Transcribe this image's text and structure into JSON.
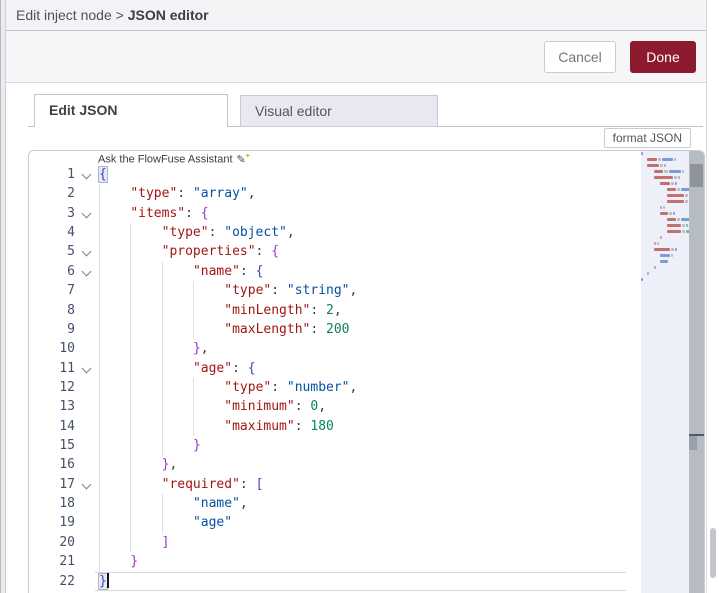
{
  "header": {
    "breadcrumb": {
      "parent": "Edit inject node",
      "separator": " > ",
      "current": "JSON editor"
    }
  },
  "toolbar": {
    "cancel_label": "Cancel",
    "done_label": "Done"
  },
  "main": {
    "tabs": [
      {
        "label": "Edit JSON",
        "active": true
      },
      {
        "label": "Visual editor",
        "active": false
      }
    ]
  },
  "editor": {
    "assistant_label": "Ask the FlowFuse Assistant",
    "assistant_icon": "pencil-icon",
    "format_button_label": "format JSON",
    "cursor_line": 22,
    "lines": [
      {
        "n": 1,
        "fold": true,
        "indent": 0,
        "tokens": [
          {
            "t": "{",
            "c": "bb",
            "m": true
          }
        ]
      },
      {
        "n": 2,
        "indent": 4,
        "tokens": [
          {
            "t": "\"type\"",
            "c": "key"
          },
          {
            "t": ": ",
            "c": "pln"
          },
          {
            "t": "\"array\"",
            "c": "str"
          },
          {
            "t": ",",
            "c": "pln"
          }
        ]
      },
      {
        "n": 3,
        "fold": true,
        "indent": 4,
        "tokens": [
          {
            "t": "\"items\"",
            "c": "key"
          },
          {
            "t": ": ",
            "c": "pln"
          },
          {
            "t": "{",
            "c": "bp"
          }
        ]
      },
      {
        "n": 4,
        "indent": 8,
        "tokens": [
          {
            "t": "\"type\"",
            "c": "key"
          },
          {
            "t": ": ",
            "c": "pln"
          },
          {
            "t": "\"object\"",
            "c": "str"
          },
          {
            "t": ",",
            "c": "pln"
          }
        ]
      },
      {
        "n": 5,
        "fold": true,
        "indent": 8,
        "tokens": [
          {
            "t": "\"properties\"",
            "c": "key"
          },
          {
            "t": ": ",
            "c": "pln"
          },
          {
            "t": "{",
            "c": "bp"
          }
        ]
      },
      {
        "n": 6,
        "fold": true,
        "indent": 12,
        "tokens": [
          {
            "t": "\"name\"",
            "c": "key"
          },
          {
            "t": ": ",
            "c": "pln"
          },
          {
            "t": "{",
            "c": "bb"
          }
        ]
      },
      {
        "n": 7,
        "indent": 16,
        "tokens": [
          {
            "t": "\"type\"",
            "c": "key"
          },
          {
            "t": ": ",
            "c": "pln"
          },
          {
            "t": "\"string\"",
            "c": "str"
          },
          {
            "t": ",",
            "c": "pln"
          }
        ]
      },
      {
        "n": 8,
        "indent": 16,
        "tokens": [
          {
            "t": "\"minLength\"",
            "c": "key"
          },
          {
            "t": ": ",
            "c": "pln"
          },
          {
            "t": "2",
            "c": "num"
          },
          {
            "t": ",",
            "c": "pln"
          }
        ]
      },
      {
        "n": 9,
        "indent": 16,
        "tokens": [
          {
            "t": "\"maxLength\"",
            "c": "key"
          },
          {
            "t": ": ",
            "c": "pln"
          },
          {
            "t": "200",
            "c": "num"
          }
        ]
      },
      {
        "n": 10,
        "indent": 12,
        "tokens": [
          {
            "t": "}",
            "c": "bp"
          },
          {
            "t": ",",
            "c": "pln"
          }
        ]
      },
      {
        "n": 11,
        "fold": true,
        "indent": 12,
        "tokens": [
          {
            "t": "\"age\"",
            "c": "key"
          },
          {
            "t": ": ",
            "c": "pln"
          },
          {
            "t": "{",
            "c": "bb"
          }
        ]
      },
      {
        "n": 12,
        "indent": 16,
        "tokens": [
          {
            "t": "\"type\"",
            "c": "key"
          },
          {
            "t": ": ",
            "c": "pln"
          },
          {
            "t": "\"number\"",
            "c": "str"
          },
          {
            "t": ",",
            "c": "pln"
          }
        ]
      },
      {
        "n": 13,
        "indent": 16,
        "tokens": [
          {
            "t": "\"minimum\"",
            "c": "key"
          },
          {
            "t": ": ",
            "c": "pln"
          },
          {
            "t": "0",
            "c": "num"
          },
          {
            "t": ",",
            "c": "pln"
          }
        ]
      },
      {
        "n": 14,
        "indent": 16,
        "tokens": [
          {
            "t": "\"maximum\"",
            "c": "key"
          },
          {
            "t": ": ",
            "c": "pln"
          },
          {
            "t": "180",
            "c": "num"
          }
        ]
      },
      {
        "n": 15,
        "indent": 12,
        "tokens": [
          {
            "t": "}",
            "c": "bp"
          }
        ]
      },
      {
        "n": 16,
        "indent": 8,
        "tokens": [
          {
            "t": "}",
            "c": "bp"
          },
          {
            "t": ",",
            "c": "pln"
          }
        ]
      },
      {
        "n": 17,
        "fold": true,
        "indent": 8,
        "tokens": [
          {
            "t": "\"required\"",
            "c": "key"
          },
          {
            "t": ": ",
            "c": "pln"
          },
          {
            "t": "[",
            "c": "bb"
          }
        ]
      },
      {
        "n": 18,
        "indent": 12,
        "tokens": [
          {
            "t": "\"name\"",
            "c": "str"
          },
          {
            "t": ",",
            "c": "pln"
          }
        ]
      },
      {
        "n": 19,
        "indent": 12,
        "tokens": [
          {
            "t": "\"age\"",
            "c": "str"
          }
        ]
      },
      {
        "n": 20,
        "indent": 8,
        "tokens": [
          {
            "t": "]",
            "c": "bp"
          }
        ]
      },
      {
        "n": 21,
        "indent": 4,
        "tokens": [
          {
            "t": "}",
            "c": "bp"
          }
        ]
      },
      {
        "n": 22,
        "indent": 0,
        "current": true,
        "cursor": true,
        "tokens": [
          {
            "t": "}",
            "c": "bb",
            "m": true
          }
        ]
      }
    ]
  },
  "colors": {
    "done_button": "#8c1b2e",
    "token_key": "#a31515",
    "token_string": "#0451a5",
    "token_number": "#098658",
    "brace_blue": "#3745cf",
    "brace_purple": "#9b35c9",
    "tab_inactive_bg": "#e8e8f2",
    "header_bg": "#f3f3f6"
  }
}
